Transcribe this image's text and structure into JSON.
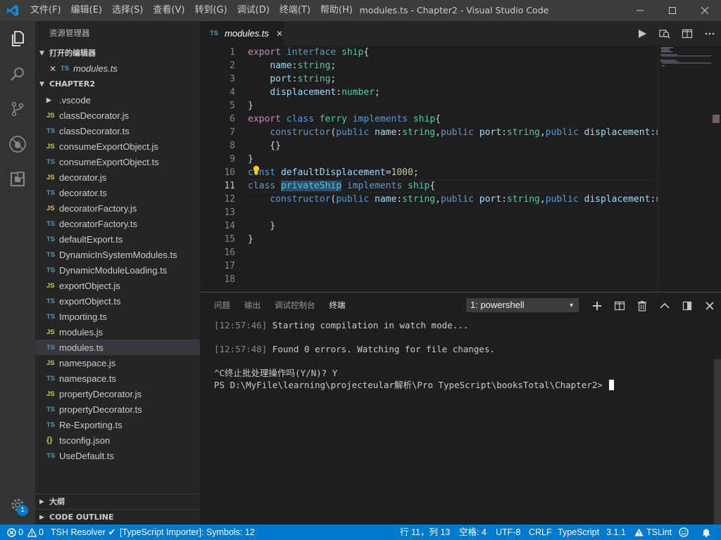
{
  "window": {
    "title": "modules.ts - Chapter2 - Visual Studio Code",
    "menu": [
      "文件(F)",
      "编辑(E)",
      "选择(S)",
      "查看(V)",
      "转到(G)",
      "调试(D)",
      "终端(T)",
      "帮助(H)"
    ]
  },
  "activity_bar": {
    "icons": [
      "explorer-icon",
      "search-icon",
      "source-control-icon",
      "debug-icon",
      "extensions-icon",
      "gear-icon"
    ],
    "settings_badge": "1"
  },
  "sidebar": {
    "title": "资源管理器",
    "open_editors": {
      "header": "打开的编辑器",
      "items": [
        {
          "icon": "TS",
          "name": "modules.ts"
        }
      ]
    },
    "folder": {
      "header": "CHAPTER2",
      "items": [
        {
          "type": "folder",
          "name": ".vscode"
        },
        {
          "type": "js",
          "name": "classDecorator.js"
        },
        {
          "type": "ts",
          "name": "classDecorator.ts"
        },
        {
          "type": "js",
          "name": "consumeExportObject.js"
        },
        {
          "type": "ts",
          "name": "consumeExportObject.ts"
        },
        {
          "type": "js",
          "name": "decorator.js"
        },
        {
          "type": "ts",
          "name": "decorator.ts"
        },
        {
          "type": "js",
          "name": "decoratorFactory.js"
        },
        {
          "type": "ts",
          "name": "decoratorFactory.ts"
        },
        {
          "type": "ts",
          "name": "defaultExport.ts"
        },
        {
          "type": "ts",
          "name": "DynamicInSystemModules.ts"
        },
        {
          "type": "ts",
          "name": "DynamicModuleLoading.ts"
        },
        {
          "type": "js",
          "name": "exportObject.js"
        },
        {
          "type": "ts",
          "name": "exportObject.ts"
        },
        {
          "type": "ts",
          "name": "Importing.ts"
        },
        {
          "type": "js",
          "name": "modules.js"
        },
        {
          "type": "ts",
          "name": "modules.ts",
          "selected": true
        },
        {
          "type": "js",
          "name": "namespace.js"
        },
        {
          "type": "ts",
          "name": "namespace.ts"
        },
        {
          "type": "js",
          "name": "propertyDecorator.js"
        },
        {
          "type": "ts",
          "name": "propertyDecorator.ts"
        },
        {
          "type": "ts",
          "name": "Re-Exporting.ts"
        },
        {
          "type": "json",
          "name": "tsconfig.json"
        },
        {
          "type": "ts",
          "name": "UseDefault.ts"
        }
      ]
    },
    "outline_header": "大纲",
    "code_outline_header": "CODE OUTLINE"
  },
  "editor": {
    "tab": {
      "icon": "TS",
      "label": "modules.ts"
    },
    "current_line": 11,
    "lines": [
      [
        [
          "kw2",
          "export"
        ],
        [
          "t",
          " "
        ],
        [
          "kw",
          "interface"
        ],
        [
          "t",
          " "
        ],
        [
          "ty",
          "ship"
        ],
        [
          "t",
          "{"
        ]
      ],
      [
        [
          "t",
          "    "
        ],
        [
          "var",
          "name"
        ],
        [
          "t",
          ":"
        ],
        [
          "ty",
          "string"
        ],
        [
          "t",
          ";"
        ]
      ],
      [
        [
          "t",
          "    "
        ],
        [
          "var",
          "port"
        ],
        [
          "t",
          ":"
        ],
        [
          "ty",
          "string"
        ],
        [
          "t",
          ";"
        ]
      ],
      [
        [
          "t",
          "    "
        ],
        [
          "var",
          "displacement"
        ],
        [
          "t",
          ":"
        ],
        [
          "ty",
          "number"
        ],
        [
          "t",
          ";"
        ]
      ],
      [
        [
          "t",
          "}"
        ]
      ],
      [
        [
          "kw2",
          "export"
        ],
        [
          "t",
          " "
        ],
        [
          "kw",
          "class"
        ],
        [
          "t",
          " "
        ],
        [
          "ty",
          "ferry"
        ],
        [
          "t",
          " "
        ],
        [
          "kw",
          "implements"
        ],
        [
          "t",
          " "
        ],
        [
          "ty",
          "ship"
        ],
        [
          "t",
          "{"
        ]
      ],
      [
        [
          "t",
          "    "
        ],
        [
          "kw",
          "constructor"
        ],
        [
          "t",
          "("
        ],
        [
          "kw",
          "public"
        ],
        [
          "t",
          " "
        ],
        [
          "var",
          "name"
        ],
        [
          "t",
          ":"
        ],
        [
          "ty",
          "string"
        ],
        [
          "t",
          ","
        ],
        [
          "kw",
          "public"
        ],
        [
          "t",
          " "
        ],
        [
          "var",
          "port"
        ],
        [
          "t",
          ":"
        ],
        [
          "ty",
          "string"
        ],
        [
          "t",
          ","
        ],
        [
          "kw",
          "public"
        ],
        [
          "t",
          " "
        ],
        [
          "var",
          "displacement"
        ],
        [
          "t",
          ":"
        ],
        [
          "ty",
          "nu"
        ]
      ],
      [
        [
          "t",
          "    {}"
        ]
      ],
      [
        [
          "t",
          "}"
        ]
      ],
      [
        [
          "kw",
          "const"
        ],
        [
          "t",
          " "
        ],
        [
          "var",
          "defaultDisplacement"
        ],
        [
          "t",
          "="
        ],
        [
          "num",
          "1000"
        ],
        [
          "t",
          ";"
        ]
      ],
      [
        [
          "kw",
          "class"
        ],
        [
          "t",
          " "
        ],
        [
          "hl",
          "privateShip"
        ],
        [
          "t",
          " "
        ],
        [
          "kw",
          "implements"
        ],
        [
          "t",
          " "
        ],
        [
          "ty",
          "ship"
        ],
        [
          "t",
          "{"
        ]
      ],
      [
        [
          "t",
          "    "
        ],
        [
          "kw",
          "constructor"
        ],
        [
          "t",
          "("
        ],
        [
          "kw",
          "public"
        ],
        [
          "t",
          " "
        ],
        [
          "var",
          "name"
        ],
        [
          "t",
          ":"
        ],
        [
          "ty",
          "string"
        ],
        [
          "t",
          ","
        ],
        [
          "kw",
          "public"
        ],
        [
          "t",
          " "
        ],
        [
          "var",
          "port"
        ],
        [
          "t",
          ":"
        ],
        [
          "ty",
          "string"
        ],
        [
          "t",
          ","
        ],
        [
          "kw",
          "public"
        ],
        [
          "t",
          " "
        ],
        [
          "var",
          "displacement"
        ],
        [
          "t",
          ":"
        ],
        [
          "ty",
          "nu"
        ]
      ],
      [
        [
          "t",
          ""
        ]
      ],
      [
        [
          "t",
          "    }"
        ]
      ],
      [
        [
          "t",
          "}"
        ]
      ],
      [
        [
          "t",
          ""
        ]
      ],
      [
        [
          "t",
          ""
        ]
      ],
      [
        [
          "t",
          ""
        ]
      ]
    ]
  },
  "panel": {
    "tabs": [
      "问题",
      "输出",
      "调试控制台",
      "终端"
    ],
    "active_tab": "终端",
    "terminal_select": "1: powershell",
    "terminal_lines": [
      {
        "ts": "[12:57:46]",
        "text": " Starting compilation in watch mode..."
      },
      {
        "ts": "",
        "text": ""
      },
      {
        "ts": "[12:57:48]",
        "text": " Found 0 errors. Watching for file changes."
      },
      {
        "ts": "",
        "text": ""
      },
      {
        "ts": "",
        "text": "^C终止批处理操作吗(Y/N)? Y"
      },
      {
        "ts": "",
        "text": "PS D:\\MyFile\\learning\\projecteular解析\\Pro TypeScript\\booksTotal\\Chapter2> ",
        "cursor": true
      }
    ]
  },
  "statusbar": {
    "errors": "0",
    "warnings": "0",
    "tsh_resolver": "TSH Resolver",
    "importer": "[TypeScript Importer]: Symbols: 12",
    "position": "行 11，列 13",
    "spaces": "空格: 4",
    "encoding": "UTF-8",
    "eol": "CRLF",
    "language": "TypeScript",
    "ts_version": "3.1.1",
    "tslint": "TSLint"
  },
  "colors": {
    "accent": "#007acc",
    "ts_icon": "#519aba",
    "js_icon": "#cbcb41"
  }
}
